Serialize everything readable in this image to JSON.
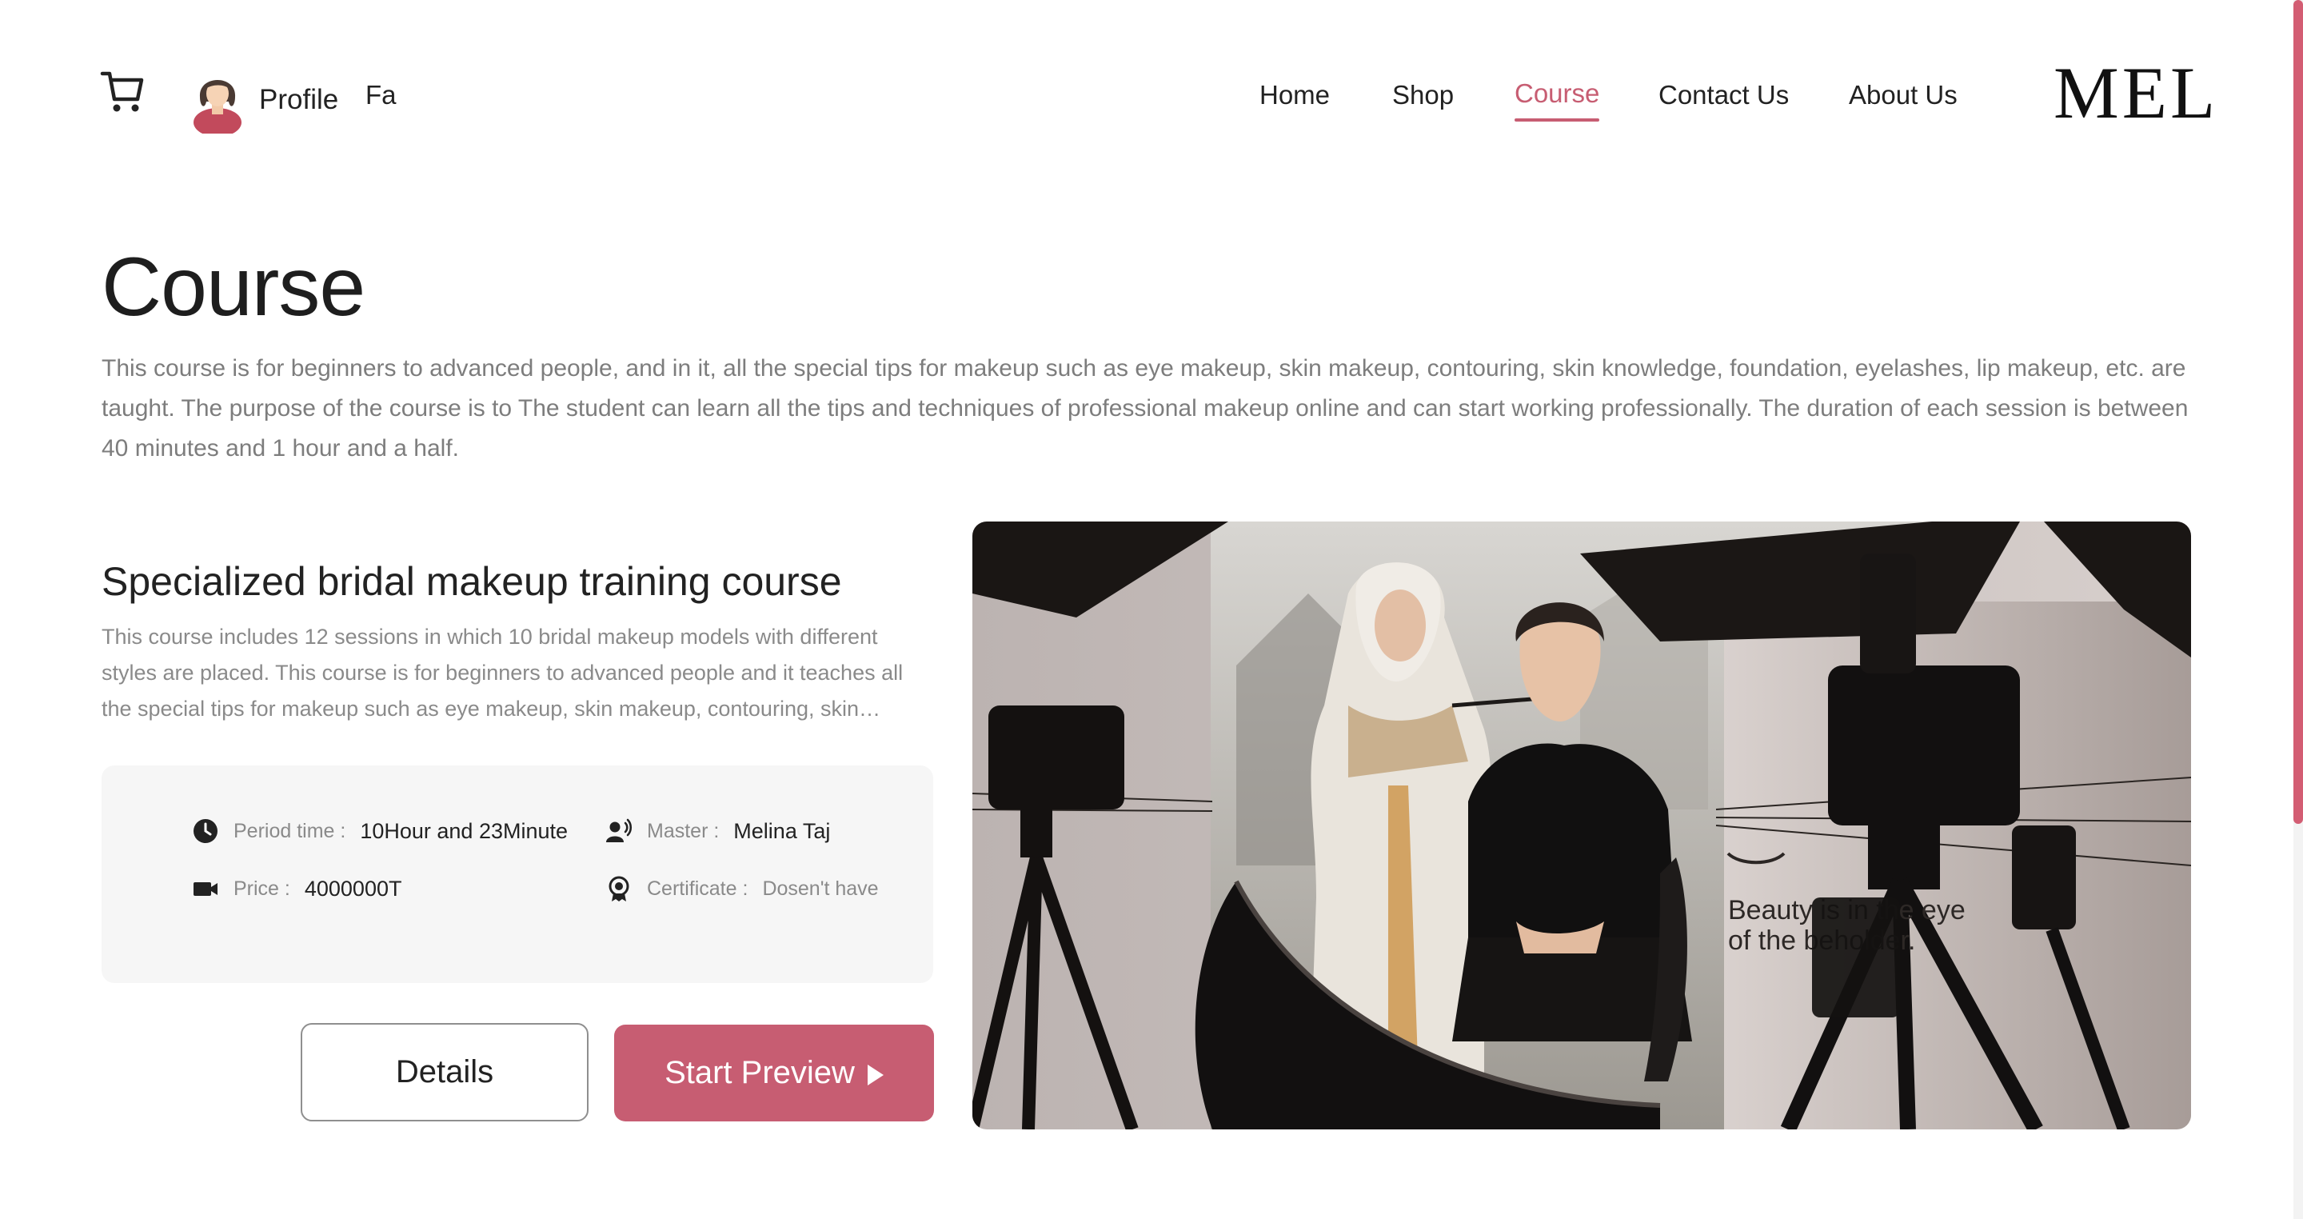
{
  "header": {
    "profile_label": "Profile",
    "lang_label": "Fa",
    "nav": [
      {
        "label": "Home",
        "active": false
      },
      {
        "label": "Shop",
        "active": false
      },
      {
        "label": "Course",
        "active": true
      },
      {
        "label": "Contact Us",
        "active": false
      },
      {
        "label": "About Us",
        "active": false
      }
    ],
    "logo": "MEL",
    "icons": {
      "cart": "cart-icon",
      "avatar": "avatar"
    }
  },
  "page": {
    "title": "Course",
    "description": "This course is for beginners to advanced people, and in it, all the special tips for makeup such as eye makeup, skin makeup, contouring, skin knowledge, foundation, eyelashes, lip makeup, etc. are taught. The purpose of the course is to The student can learn all the tips and techniques of professional makeup online and can start working professionally. The duration of each session is between 40 minutes and 1 hour and a half."
  },
  "course": {
    "title": "Specialized bridal makeup training course",
    "description": "This course includes 12 sessions in which 10 bridal makeup models with different styles are placed. This course is for beginners to advanced people and it teaches all the special tips for makeup such as eye makeup, skin makeup, contouring, skin recognition...",
    "info": {
      "period_label": "Period time :",
      "period_value": "10Hour and 23Minute",
      "master_label": "Master :",
      "master_value": "Melina Taj",
      "price_label": "Price :",
      "price_value": "4000000T",
      "certificate_label": "Certificate :",
      "certificate_value": "Dosen't have"
    },
    "details_button": "Details",
    "preview_button": "Start Preview",
    "image_caption_line1": "Beauty is in the eye",
    "image_caption_line2": "of the beholder."
  },
  "colors": {
    "accent": "#c75d72",
    "text": "#222222",
    "muted": "#7d7d7d",
    "card_bg": "#f6f6f6"
  }
}
